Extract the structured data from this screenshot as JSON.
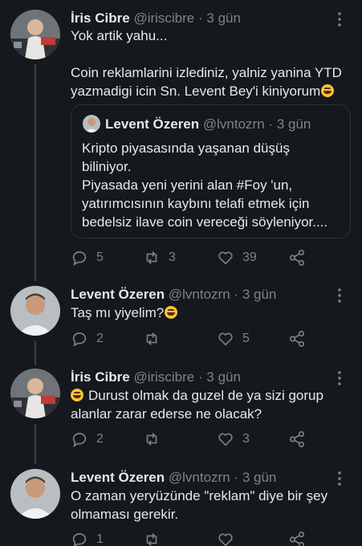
{
  "tweets": [
    {
      "name": "İris Cibre",
      "handle": "@iriscibre",
      "time": "3 gün",
      "lines": [
        "Yok artik yahu...",
        "",
        "Coin reklamlarini izlediniz, yalniz yanina YTD",
        "yazmadigi icin Sn. Levent Bey'i kiniyorum"
      ],
      "quote": {
        "name": "Levent Özeren",
        "handle": "@lvntozrn",
        "time": "3 gün",
        "lines": [
          "Kripto piyasasında yaşanan düşüş",
          "biliniyor.",
          "Piyasada yeni yerini alan #Foy 'un,",
          "yatırımcısının kaybını telafi etmek için",
          "bedelsiz ilave coin vereceği söyleniyor...."
        ]
      },
      "replies": "5",
      "retweets": "3",
      "likes": "39"
    },
    {
      "name": "Levent Özeren",
      "handle": "@lvntozrn",
      "time": "3 gün",
      "lines": [
        "Taş mı yiyelim?"
      ],
      "replies": "2",
      "retweets": "",
      "likes": "5"
    },
    {
      "name": "İris Cibre",
      "handle": "@iriscibre",
      "time": "3 gün",
      "lines": [
        "Durust olmak da guzel de ya sizi gorup",
        "alanlar zarar ederse ne olacak?"
      ],
      "replies": "2",
      "retweets": "",
      "likes": "3"
    },
    {
      "name": "Levent Özeren",
      "handle": "@lvntozrn",
      "time": "3 gün",
      "lines": [
        "O zaman yeryüzünde \"reklam\" diye bir şey",
        "olmaması gerekir."
      ],
      "replies": "1",
      "retweets": "",
      "likes": ""
    }
  ],
  "sep": "·",
  "colors": {
    "background": "#15181c",
    "text": "#e7e9ea",
    "muted": "#7d8489",
    "border": "#2f3336"
  }
}
